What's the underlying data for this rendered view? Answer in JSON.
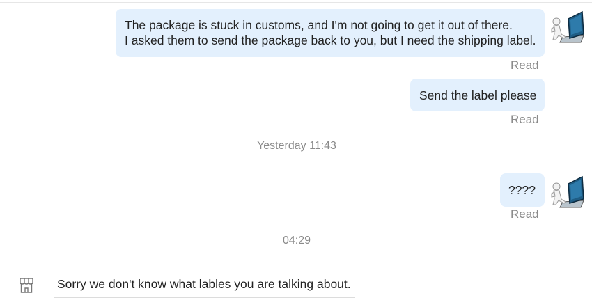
{
  "messages": [
    {
      "direction": "outgoing",
      "lines": [
        "The package is stuck in customs, and I'm not going to get it out of there.",
        "I asked them to send the package back to you, but I need the shipping label."
      ],
      "status": "Read"
    },
    {
      "direction": "outgoing",
      "text": "Send the label please",
      "status": "Read"
    },
    {
      "direction": "outgoing",
      "text": "????",
      "status": "Read"
    },
    {
      "direction": "incoming",
      "text": "Sorry we don't know what lables you are talking about."
    }
  ],
  "timestamps": [
    "Yesterday 11:43",
    "04:29"
  ],
  "icons": {
    "user_avatar": "person-with-laptop-avatar",
    "seller_avatar": "store-icon"
  },
  "colors": {
    "outgoing_bubble": "#e3f0fd",
    "status_text": "#8a8a8a",
    "body_text": "#222222",
    "avatar_screen": "#1f5d85"
  }
}
